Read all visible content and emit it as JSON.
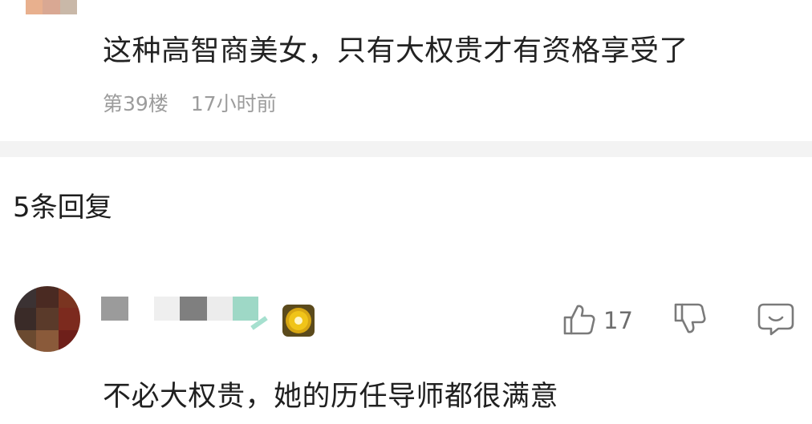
{
  "top_comment": {
    "text": "这种高智商美女，只有大权贵才有资格享受了",
    "floor": "第39楼",
    "time": "17小时前"
  },
  "replies_header": "5条回复",
  "reply": {
    "like_count": "17",
    "text": "不必大权贵，她的历任导师都很满意"
  },
  "icons": {
    "like": "thumbs-up-icon",
    "dislike": "thumbs-down-icon",
    "reply": "comment-bubble-icon",
    "badge": "sun-badge-icon"
  },
  "colors": {
    "text": "#222222",
    "meta": "#9c9c9c",
    "divider": "#f3f3f3",
    "icon": "#7a7a7a"
  }
}
